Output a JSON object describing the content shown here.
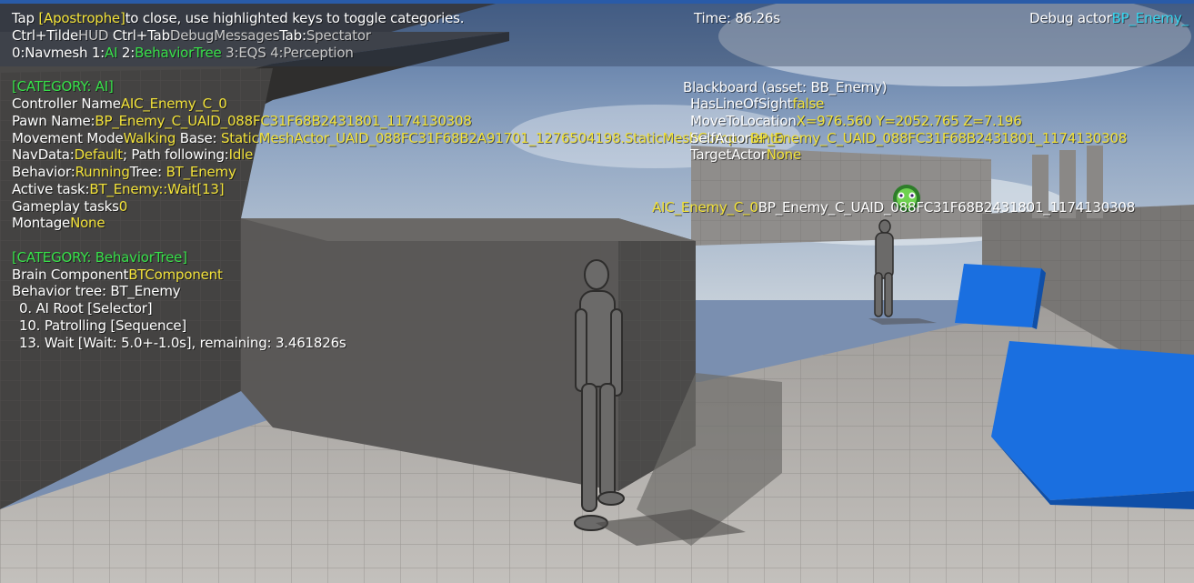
{
  "topbar": {
    "tap_prefix": "Tap ",
    "tap_key": "[Apostrophe]",
    "tap_suffix": "to close, use highlighted keys to toggle categories.",
    "time": "Time: 86.26s",
    "debug_actor_label": "Debug actor",
    "debug_actor_value": "BP_Enemy_",
    "ctrl_tilde": "Ctrl+Tilde",
    "hud": "HUD",
    "ctrl_tab": "Ctrl+Tab",
    "debug_messages": "DebugMessages",
    "tab": "Tab:",
    "spectator": "Spectator",
    "cat0": "0:Navmesh",
    "cat1_key": "1:",
    "cat1": "AI",
    "cat2_key": "2:",
    "cat2": "BehaviorTree",
    "cat3": "3:EQS",
    "cat4": "4:Perception"
  },
  "ai_category": {
    "header": "[CATEGORY: AI]",
    "controller_name_label": "Controller Name",
    "controller_name": "AIC_Enemy_C_0",
    "pawn_name_label": "Pawn Name:",
    "pawn_name": "BP_Enemy_C_UAID_088FC31F68B2431801_1174130308",
    "movement_mode_label": "Movement Mode",
    "movement_mode": "Walking",
    "base_label": " Base: ",
    "base_value": "StaticMeshActor_UAID_088FC31F68B2A91701_1276504198.StaticMeshComponent0",
    "navdata_label": "NavData:",
    "navdata": "Default",
    "path_label": "; Path following:",
    "path": "Idle",
    "behavior_label": "Behavior:",
    "behavior": "Running",
    "tree_label": "Tree: ",
    "tree": "BT_Enemy",
    "active_task_label": "Active task:",
    "active_task": "BT_Enemy::Wait[13]",
    "gameplay_tasks_label": "Gameplay tasks",
    "gameplay_tasks": "0",
    "montage_label": "Montage",
    "montage": "None"
  },
  "bt_category": {
    "header": "[CATEGORY: BehaviorTree]",
    "brain_label": "Brain Component",
    "brain": "BTComponent",
    "tree_line": "Behavior tree: BT_Enemy",
    "node0": "0. AI Root [Selector]",
    "node10": "10. Patrolling [Sequence]",
    "node13": "13. Wait [Wait: 5.0+-1.0s], remaining: 3.461826s"
  },
  "blackboard": {
    "title": "Blackboard (asset: BB_Enemy)",
    "has_los_label": "HasLineOfSight",
    "has_los": "false",
    "move_to_label": "MoveToLocation",
    "move_to": "X=976.560 Y=2052.765 Z=7.196",
    "self_actor_label": "SelfActor",
    "self_actor": "BP_Enemy_C_UAID_088FC31F68B2431801_1174130308",
    "target_actor_label": "TargetActor",
    "target_actor": "None"
  },
  "world_label": {
    "controller": "AIC_Enemy_C_0",
    "pawn": "BP_Enemy_C_UAID_088FC31F68B2431801_1174130308"
  },
  "colors": {
    "highlight_yellow": "#f2e23a",
    "highlight_green": "#38e04a",
    "inactive_gray": "#c8c8c8",
    "debug_cyan": "#37d6f0",
    "cube_blue": "#1a6fe0"
  }
}
